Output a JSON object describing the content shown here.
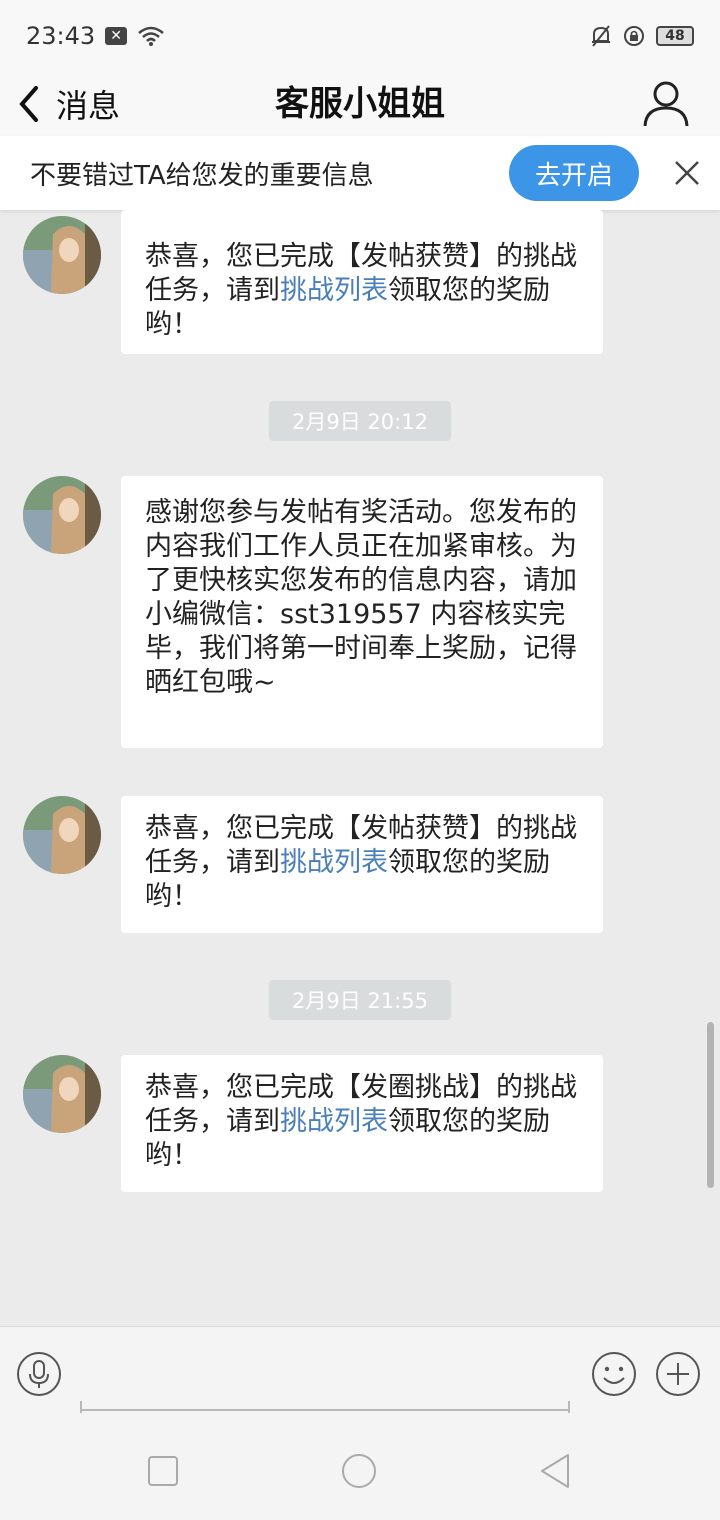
{
  "status_bar": {
    "time": "23:43",
    "battery": "48"
  },
  "header": {
    "back_label": "消息",
    "title": "客服小姐姐"
  },
  "notification": {
    "text": "不要错过TA给您发的重要信息",
    "button_label": "去开启"
  },
  "messages": [
    {
      "part1": "恭喜，您已完成【发帖获赞】的挑战任务，请到",
      "link": "挑战列表",
      "part2": "领取您的奖励哟！"
    },
    {
      "timestamp": "2月9日 20:12",
      "text": "感谢您参与发帖有奖活动。您发布的内容我们工作人员正在加紧审核。为了更快核实您发布的信息内容，请加小编微信：sst319557 内容核实完毕，我们将第一时间奉上奖励，记得晒红包哦~"
    },
    {
      "part1": "恭喜，您已完成【发帖获赞】的挑战任务，请到",
      "link": "挑战列表",
      "part2": "领取您的奖励哟！"
    },
    {
      "timestamp": "2月9日 21:55",
      "part1": "恭喜，您已完成【发圈挑战】的挑战任务，请到",
      "link": "挑战列表",
      "part2": "领取您的奖励哟！"
    }
  ],
  "colors": {
    "accent": "#3d95e8",
    "link": "#4a7fb8",
    "background": "#ebebeb"
  }
}
